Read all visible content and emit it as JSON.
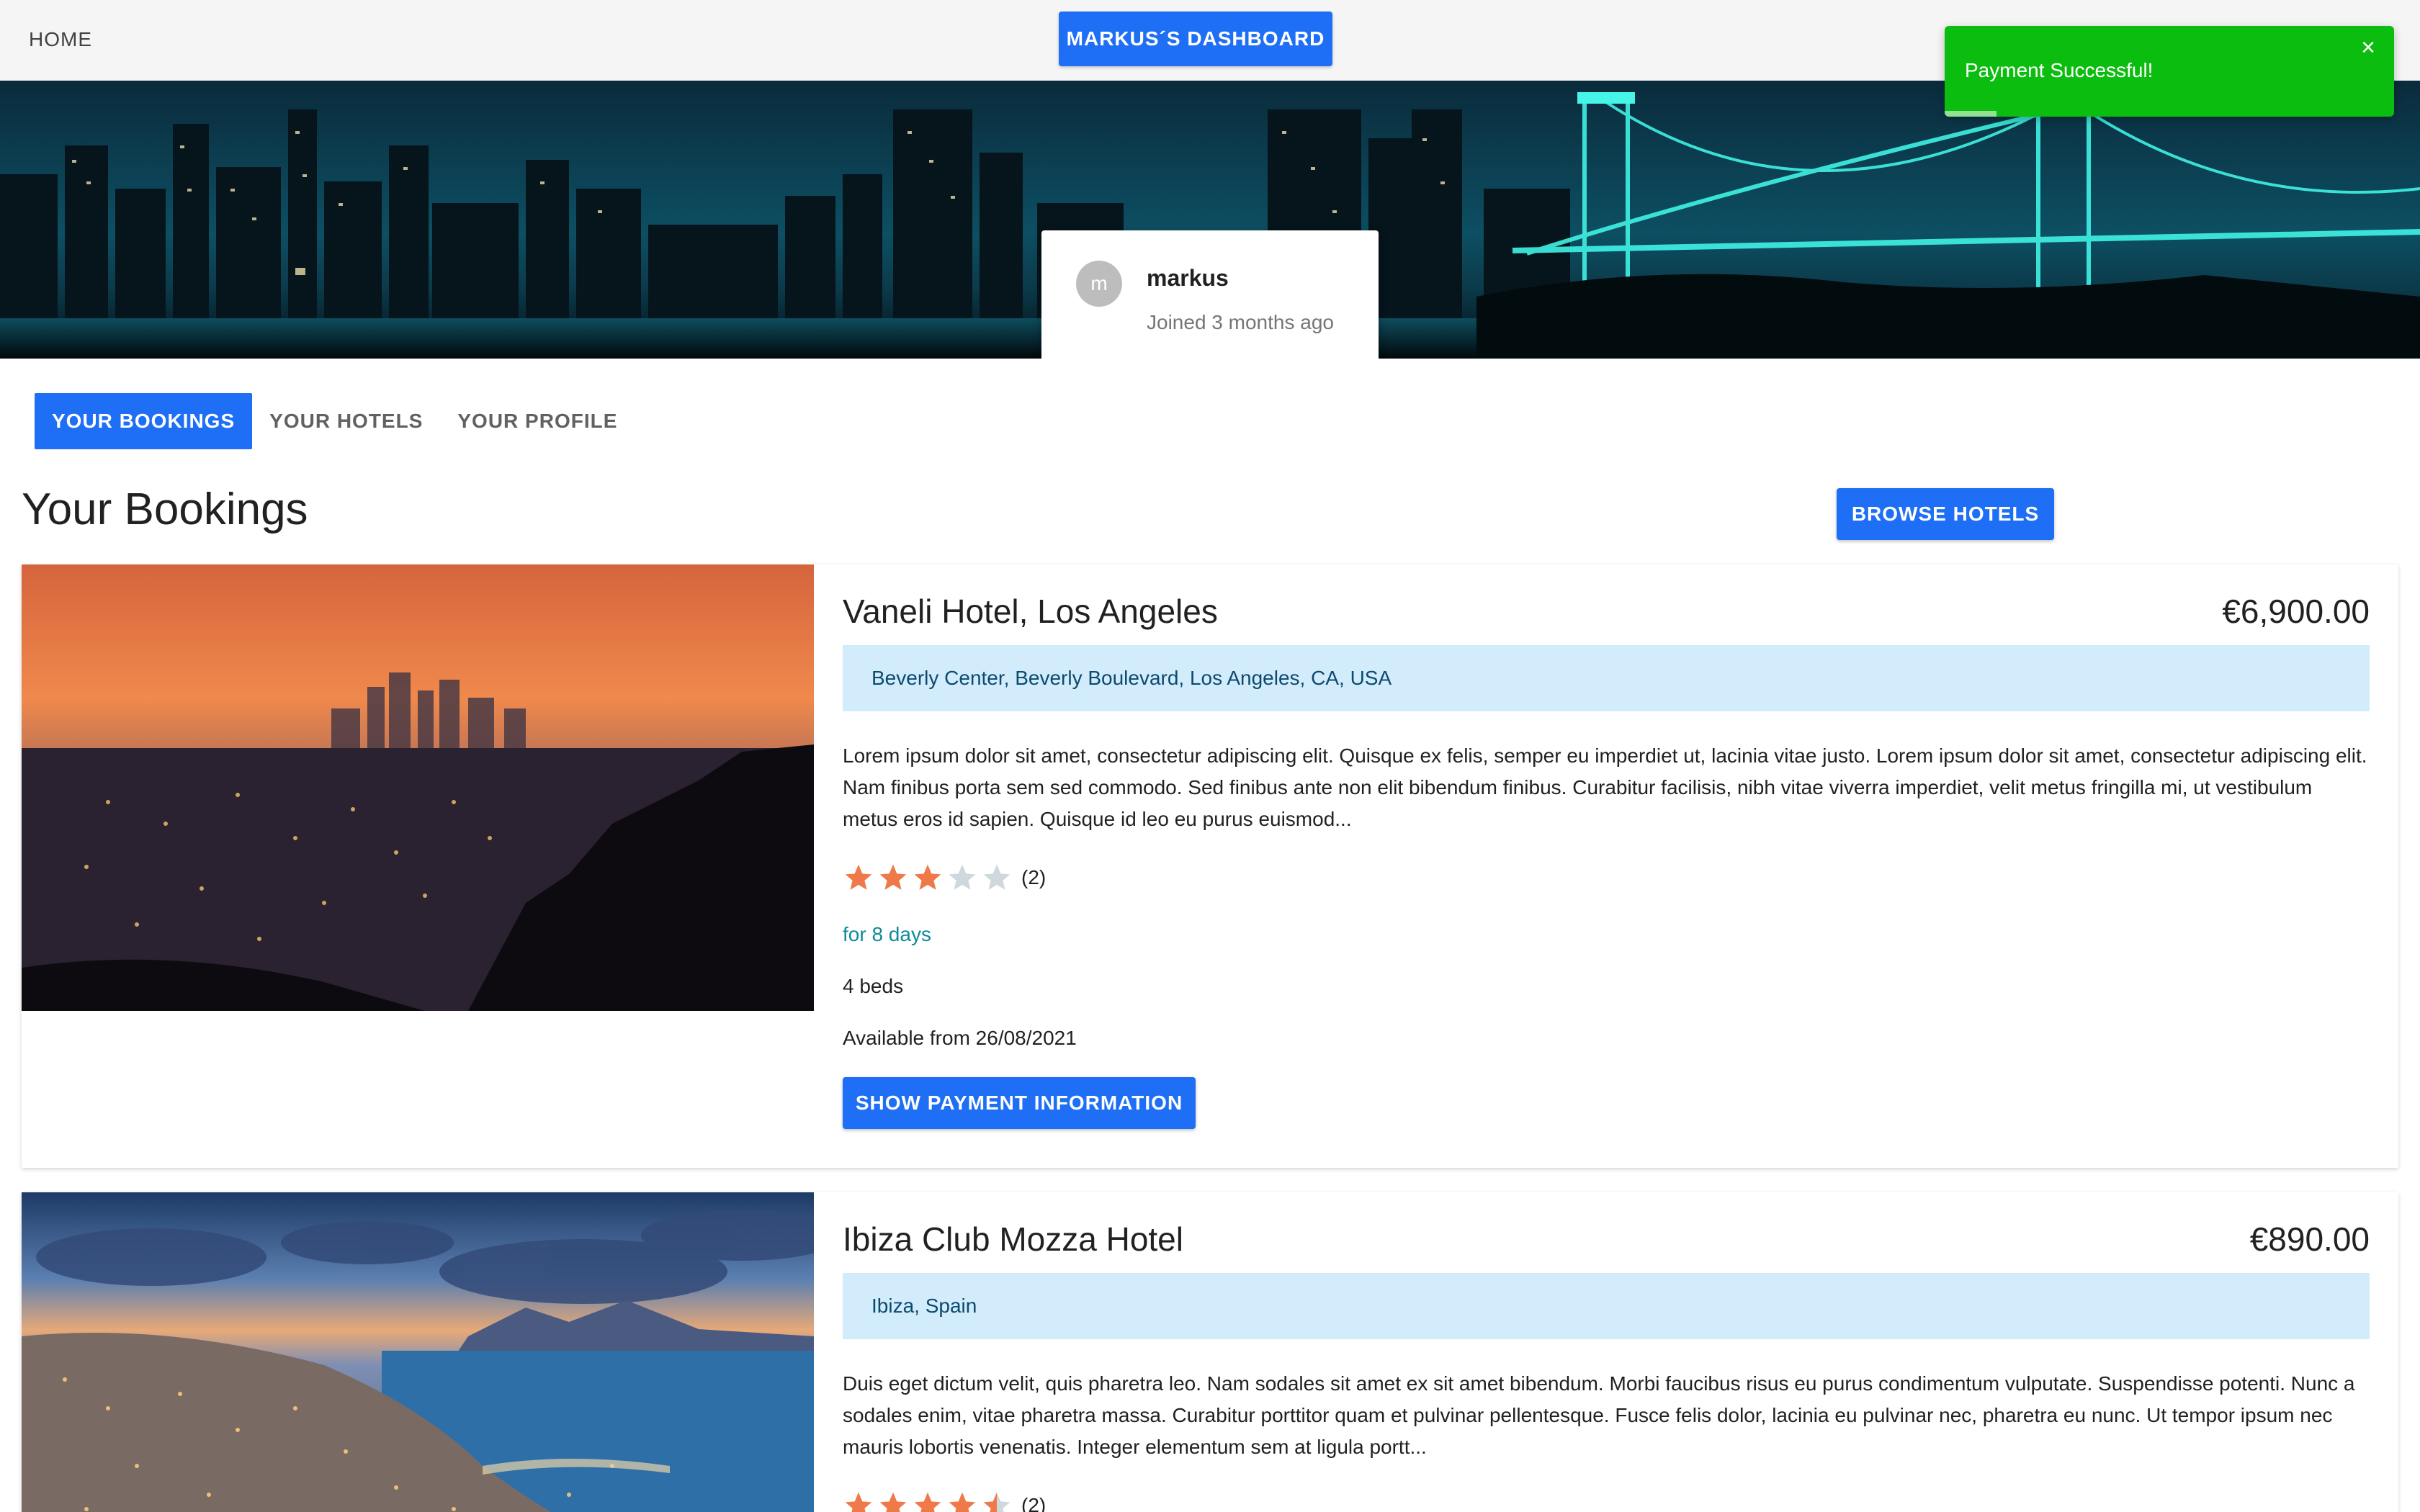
{
  "nav": {
    "home_label": "HOME",
    "dashboard_label": "MARKUS´S DASHBOARD"
  },
  "profile": {
    "avatar_initial": "m",
    "name": "markus",
    "joined": "Joined 3 months ago"
  },
  "toast": {
    "message": "Payment Successful!",
    "close_icon": "×",
    "color": "#0bbd0f"
  },
  "tabs": [
    {
      "label": "YOUR BOOKINGS",
      "active": true
    },
    {
      "label": "YOUR HOTELS",
      "active": false
    },
    {
      "label": "YOUR PROFILE",
      "active": false
    }
  ],
  "section": {
    "title": "Your Bookings",
    "browse_label": "BROWSE HOTELS"
  },
  "bookings": [
    {
      "name": "Vaneli Hotel, Los Angeles",
      "price": "€6,900.00",
      "address": "Beverly Center, Beverly Boulevard, Los Angeles, CA, USA",
      "description": "Lorem ipsum dolor sit amet, consectetur adipiscing elit. Quisque ex felis, semper eu imperdiet ut, lacinia vitae justo. Lorem ipsum dolor sit amet, consectetur adipiscing elit. Nam finibus porta sem sed commodo. Sed finibus ante non elit bibendum finibus. Curabitur facilisis, nibh vitae viverra imperdiet, velit metus fringilla mi, ut vestibulum metus eros id sapien. Quisque id leo eu purus euismod...",
      "rating": 3,
      "rating_count": "(2)",
      "duration": "for 8 days",
      "beds": "4 beds",
      "available": "Available from 26/08/2021",
      "payment_label": "SHOW PAYMENT INFORMATION",
      "image": "sunset-city-photo"
    },
    {
      "name": "Ibiza Club Mozza Hotel",
      "price": "€890.00",
      "address": "Ibiza, Spain",
      "description": "Duis eget dictum velit, quis pharetra leo. Nam sodales sit amet ex sit amet bibendum. Morbi faucibus risus eu purus condimentum vulputate. Suspendisse potenti. Nunc a sodales enim, vitae pharetra massa. Curabitur porttitor quam et pulvinar pellentesque. Fusce felis dolor, lacinia eu pulvinar nec, pharetra eu nunc. Ut tempor ipsum nec mauris lobortis venenatis. Integer elementum sem at ligula portt...",
      "rating": 4.5,
      "rating_count": "(2)",
      "image": "coastal-bay-photo"
    }
  ],
  "colors": {
    "primary": "#1e6ff5",
    "star_filled": "#f0794a",
    "star_empty": "#cfd8dc",
    "address_bg": "#d3ecfc",
    "duration_text": "#0e8a9a"
  }
}
